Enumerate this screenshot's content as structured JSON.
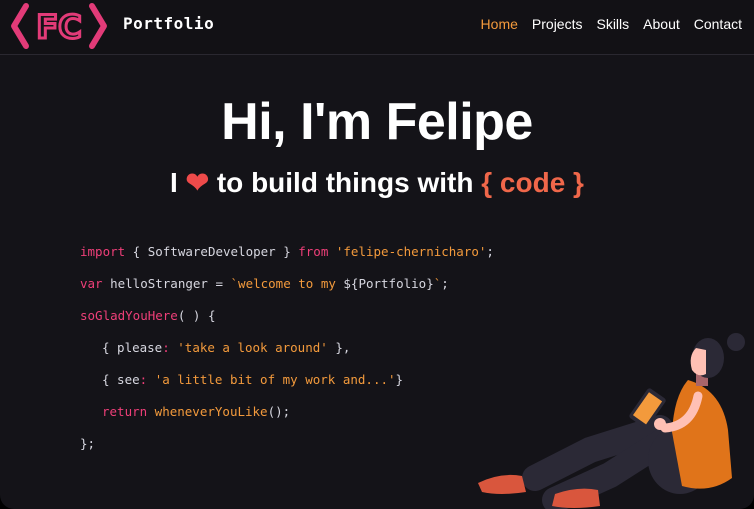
{
  "logo": {
    "text": "FC"
  },
  "brand": "Portfolio",
  "nav": [
    {
      "label": "Home",
      "active": true
    },
    {
      "label": "Projects",
      "active": false
    },
    {
      "label": "Skills",
      "active": false
    },
    {
      "label": "About",
      "active": false
    },
    {
      "label": "Contact",
      "active": false
    }
  ],
  "hero": {
    "title": "Hi, I'm Felipe",
    "sub_before": "I",
    "heart": "❤",
    "sub_after": "to build things with",
    "code_word": "{ code }"
  },
  "code": {
    "l1_kw": "import",
    "l1_mid": " { SoftwareDeveloper } ",
    "l1_kw2": "from",
    "l1_str": " 'felipe-chernicharo'",
    "l1_end": ";",
    "l2_kw": "var",
    "l2_mid": " helloStranger = ",
    "l2_str1": "`welcome to my ",
    "l2_var": "${Portfolio}",
    "l2_str2": "`",
    "l2_end": ";",
    "l3_fn": "soGladYouHere",
    "l3_end": "( ) {",
    "l4_open": "{ please",
    "l4_colon": ":",
    "l4_str": " 'take a look around'",
    "l4_end": " },",
    "l5_open": "{ see",
    "l5_colon": ":",
    "l5_str": " 'a little bit of my work and...'",
    "l5_end": "}",
    "l6_kw": "return",
    "l6_fn": " wheneverYouLike",
    "l6_end": "();",
    "l7": "};"
  },
  "colors": {
    "accent": "#f39a3c",
    "keyword": "#ef3f79",
    "background": "#141318",
    "logo": "#e23b78"
  }
}
